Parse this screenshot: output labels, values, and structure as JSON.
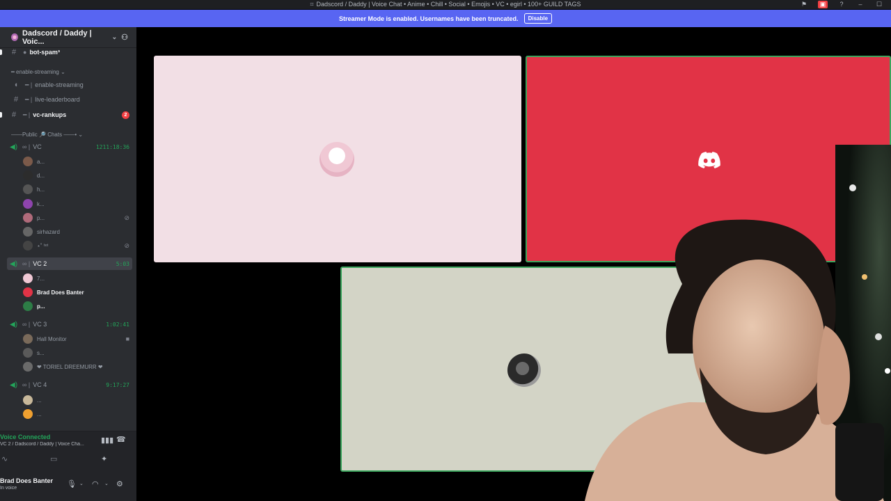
{
  "window": {
    "title": "Dadscord / Daddy | Voice Chat • Anime • Chill • Social • Emojis • VC • egirl • 100+ GUILD TAGS",
    "icons": [
      "flag-icon",
      "inbox-icon",
      "help-icon",
      "minimize-icon",
      "maximize-icon"
    ]
  },
  "banner": {
    "text": "Streamer Mode is enabled. Usernames have been truncated.",
    "button": "Disable",
    "color": "#5865f2"
  },
  "server": {
    "name": "Dadscord / Daddy | Voic..."
  },
  "channels": [
    {
      "label": "bot-spam³",
      "icon": "hash-icon",
      "unread": true
    },
    {
      "label": "enable-streaming",
      "type": "category"
    },
    {
      "label": "enable-streaming",
      "icon": "voice-icon"
    },
    {
      "label": "live-leaderboard",
      "icon": "hash-icon"
    },
    {
      "label": "vc-rankups",
      "icon": "hash-icon",
      "unread": true,
      "badge": "2"
    },
    {
      "label": "——Public 🔎 Chats ——•",
      "type": "category"
    }
  ],
  "voice_channels": [
    {
      "name": "VC",
      "time": "1211:18:36",
      "users": [
        {
          "name": "a...",
          "color": "#7b5a4a"
        },
        {
          "name": "d...",
          "color": "#2c2c2c"
        },
        {
          "name": "h...",
          "color": "#555555"
        },
        {
          "name": "k...",
          "color": "#8e44ad"
        },
        {
          "name": "p...",
          "color": "#b06a7a"
        },
        {
          "name": "sirhazard",
          "color": "#666666"
        },
        {
          "name": "⋆˚ ᵗᵉᵗ",
          "color": "#444444"
        }
      ]
    },
    {
      "name": "VC 2",
      "time": "5:03",
      "selected": true,
      "users": [
        {
          "name": "7...",
          "color": "#f0c8d4"
        },
        {
          "name": "Brad Does Banter",
          "color": "#e13346",
          "bold": true
        },
        {
          "name": "p...",
          "color": "#2d7d46",
          "bold": true
        }
      ]
    },
    {
      "name": "VC 3",
      "time": "1:02:41",
      "users": [
        {
          "name": "Hall Monitor",
          "color": "#7a6a5a"
        },
        {
          "name": "s...",
          "color": "#5a5a5a"
        },
        {
          "name": "❤ TORIEL DREEMURR ❤",
          "color": "#6a6a6a"
        }
      ]
    },
    {
      "name": "VC 4",
      "time": "9:17:27",
      "users": [
        {
          "name": "...",
          "color": "#c8b89a"
        },
        {
          "name": "...",
          "color": "#f0a030"
        }
      ]
    }
  ],
  "voice_panel": {
    "status": "Voice Connected",
    "channel": "VC 2 / Dadscord / Daddy | Voice Cha..."
  },
  "user_panel": {
    "name": "Brad Does Banter",
    "status": "In voice"
  },
  "colors": {
    "accent": "#5865f2",
    "speaking": "#3ba55d",
    "voice_green": "#23a55a",
    "mention": "#f23f43"
  }
}
